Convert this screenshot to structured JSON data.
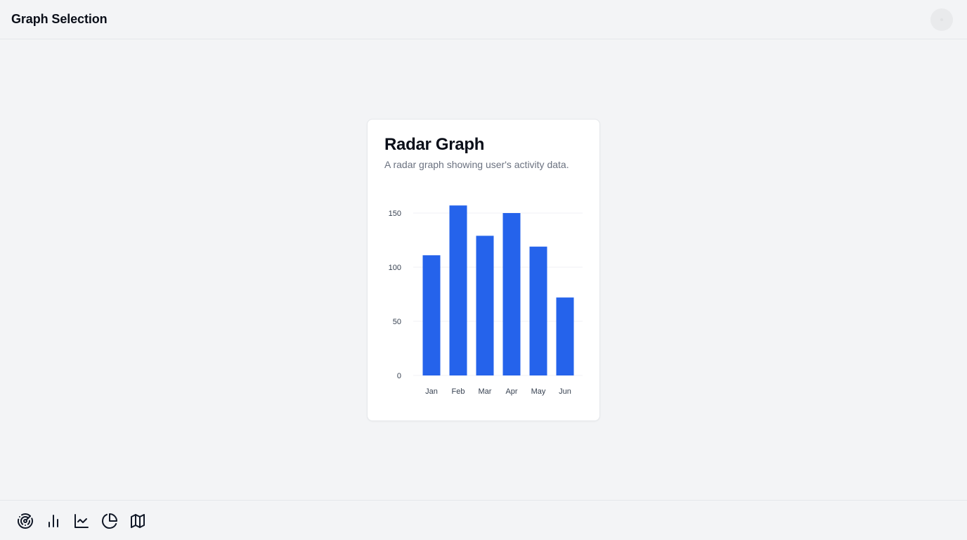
{
  "header": {
    "title": "Graph Selection",
    "avatar_icon": "user-avatar-icon"
  },
  "card": {
    "title": "Radar Graph",
    "subtitle": "A radar graph showing user's activity data."
  },
  "chart_data": {
    "type": "bar",
    "title": "",
    "xlabel": "",
    "ylabel": "",
    "categories": [
      "Jan",
      "Feb",
      "Mar",
      "Apr",
      "May",
      "Jun"
    ],
    "series": [
      {
        "values": [
          111,
          157,
          129,
          150,
          119,
          72
        ]
      }
    ],
    "ylim": [
      0,
      150
    ],
    "yticks": [
      "0",
      "50",
      "100",
      "150"
    ],
    "grid": true,
    "bar_color": "#2563eb"
  },
  "footer": {
    "icons": [
      "radar-icon",
      "bar-chart-icon",
      "line-chart-icon",
      "pie-chart-icon",
      "map-icon"
    ]
  }
}
